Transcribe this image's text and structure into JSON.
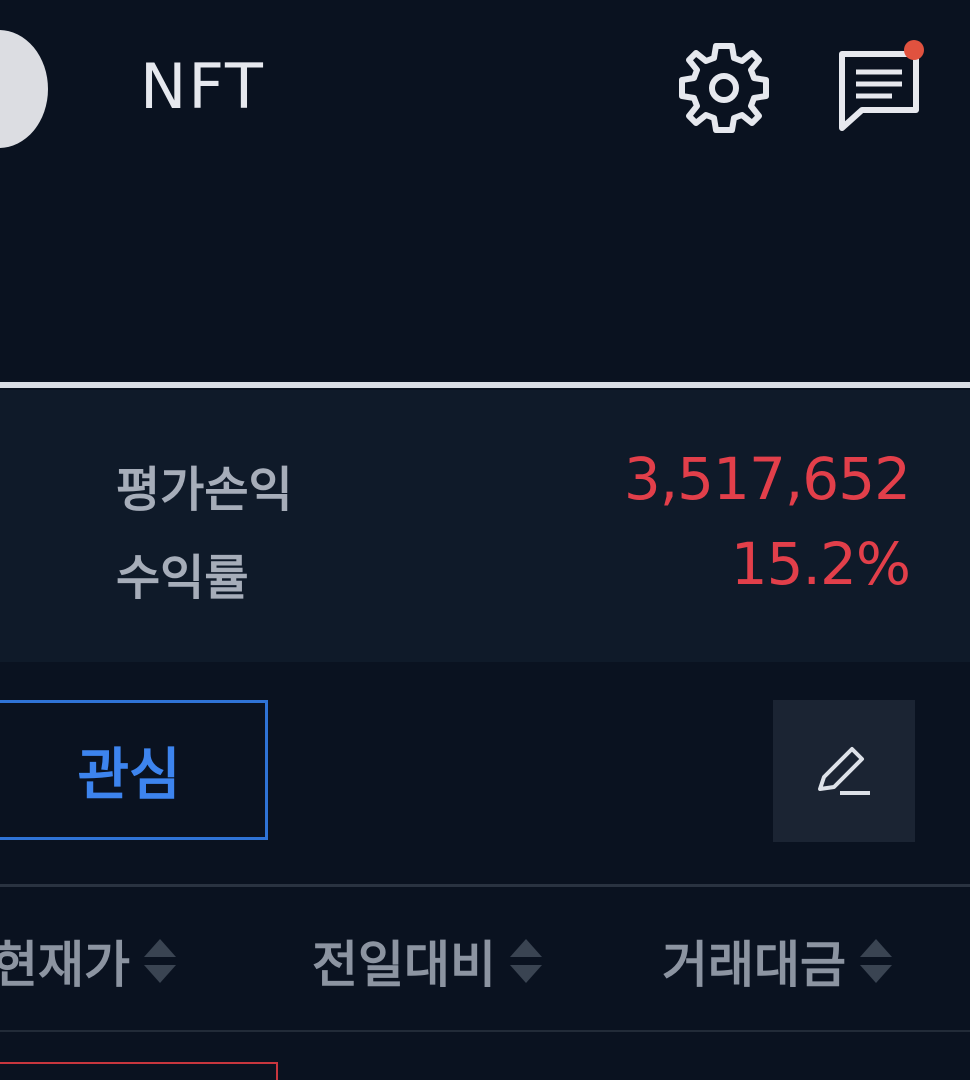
{
  "header": {
    "title": "NFT",
    "settings_icon": "gear-icon",
    "messages_icon": "chat-icon",
    "has_notification": true
  },
  "summary": {
    "profit_loss_label": "평가손익",
    "profit_loss_value": "3,517,652",
    "return_rate_label": "수익률",
    "return_rate_value": "15.2%"
  },
  "tabs": {
    "watchlist_label": "관심",
    "edit_icon": "pencil-icon"
  },
  "table": {
    "columns": [
      {
        "label": "현재가"
      },
      {
        "label": "전일대비"
      },
      {
        "label": "거래대금"
      }
    ]
  },
  "colors": {
    "background": "#0a1220",
    "panel": "#0f1a29",
    "positive": "#e23f4a",
    "accent": "#2f73d6",
    "notification": "#e0523f"
  }
}
